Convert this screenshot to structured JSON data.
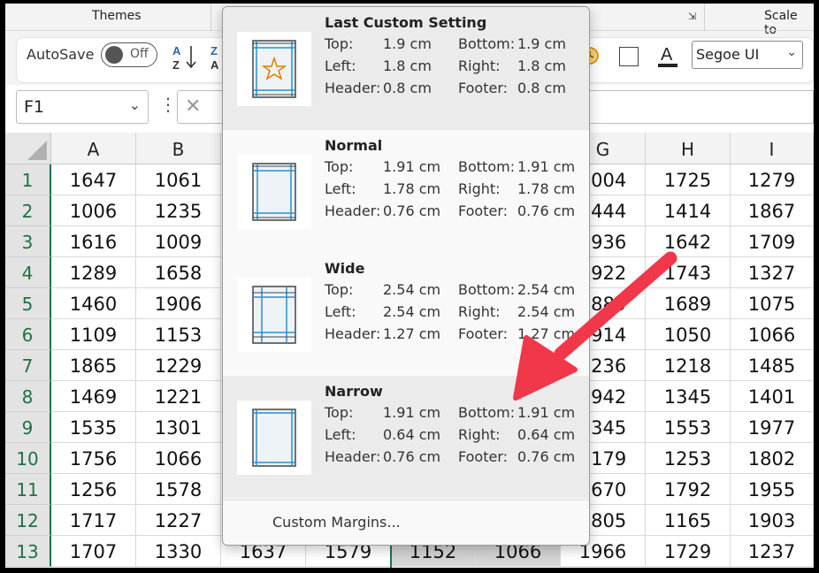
{
  "ribbon": {
    "themes_label": "Themes",
    "scale_label": "Scale to",
    "autosave_label": "AutoSave",
    "autosave_state": "Off",
    "font_name": "Segoe UI"
  },
  "formula_bar": {
    "name_box": "F1"
  },
  "sheet": {
    "columns": [
      "A",
      "B",
      "C",
      "D",
      "E",
      "F",
      "G",
      "H",
      "I"
    ],
    "rows": [
      {
        "num": "1",
        "cells": [
          "1647",
          "1061",
          "",
          "",
          "",
          "",
          "1004",
          "1725",
          "1279"
        ]
      },
      {
        "num": "2",
        "cells": [
          "1006",
          "1235",
          "",
          "",
          "",
          "",
          "1444",
          "1414",
          "1867"
        ]
      },
      {
        "num": "3",
        "cells": [
          "1616",
          "1009",
          "",
          "",
          "",
          "",
          "1936",
          "1642",
          "1709"
        ]
      },
      {
        "num": "4",
        "cells": [
          "1289",
          "1658",
          "",
          "",
          "",
          "",
          "1922",
          "1743",
          "1327"
        ]
      },
      {
        "num": "5",
        "cells": [
          "1460",
          "1906",
          "",
          "",
          "",
          "",
          "1889",
          "1689",
          "1075"
        ]
      },
      {
        "num": "6",
        "cells": [
          "1109",
          "1153",
          "",
          "",
          "",
          "",
          "1914",
          "1050",
          "1066"
        ]
      },
      {
        "num": "7",
        "cells": [
          "1865",
          "1229",
          "",
          "",
          "",
          "",
          "1236",
          "1218",
          "1485"
        ]
      },
      {
        "num": "8",
        "cells": [
          "1469",
          "1221",
          "",
          "",
          "",
          "",
          "1942",
          "1345",
          "1401"
        ]
      },
      {
        "num": "9",
        "cells": [
          "1535",
          "1301",
          "",
          "",
          "",
          "",
          "1345",
          "1553",
          "1977"
        ]
      },
      {
        "num": "10",
        "cells": [
          "1756",
          "1066",
          "",
          "",
          "",
          "",
          "1179",
          "1253",
          "1802"
        ]
      },
      {
        "num": "11",
        "cells": [
          "1256",
          "1578",
          "",
          "",
          "",
          "",
          "1670",
          "1792",
          "1955"
        ]
      },
      {
        "num": "12",
        "cells": [
          "1717",
          "1227",
          "",
          "",
          "",
          "",
          "1805",
          "1165",
          "1903"
        ]
      },
      {
        "num": "13",
        "cells": [
          "1707",
          "1330",
          "1637",
          "1579",
          "1152",
          "1066",
          "1966",
          "1729",
          "1237"
        ]
      }
    ]
  },
  "margins_menu": {
    "options": [
      {
        "title": "Last Custom Setting",
        "top_label": "Top:",
        "top": "1.9 cm",
        "bottom_label": "Bottom:",
        "bottom": "1.9 cm",
        "left_label": "Left:",
        "left": "1.8 cm",
        "right_label": "Right:",
        "right": "1.8 cm",
        "header_label": "Header:",
        "header": "0.8 cm",
        "footer_label": "Footer:",
        "footer": "0.8 cm"
      },
      {
        "title": "Normal",
        "top_label": "Top:",
        "top": "1.91 cm",
        "bottom_label": "Bottom:",
        "bottom": "1.91 cm",
        "left_label": "Left:",
        "left": "1.78 cm",
        "right_label": "Right:",
        "right": "1.78 cm",
        "header_label": "Header:",
        "header": "0.76 cm",
        "footer_label": "Footer:",
        "footer": "0.76 cm"
      },
      {
        "title": "Wide",
        "top_label": "Top:",
        "top": "2.54 cm",
        "bottom_label": "Bottom:",
        "bottom": "2.54 cm",
        "left_label": "Left:",
        "left": "2.54 cm",
        "right_label": "Right:",
        "right": "2.54 cm",
        "header_label": "Header:",
        "header": "1.27 cm",
        "footer_label": "Footer:",
        "footer": "1.27 cm"
      },
      {
        "title": "Narrow",
        "top_label": "Top:",
        "top": "1.91 cm",
        "bottom_label": "Bottom:",
        "bottom": "1.91 cm",
        "left_label": "Left:",
        "left": "0.64 cm",
        "right_label": "Right:",
        "right": "0.64 cm",
        "header_label": "Header:",
        "header": "0.76 cm",
        "footer_label": "Footer:",
        "footer": "0.76 cm"
      }
    ],
    "custom_margins": "Custom Margins..."
  },
  "colors": {
    "accent_green": "#1e7145",
    "annotation_red": "#f0384a",
    "preview_blue": "#2a8fd0"
  }
}
